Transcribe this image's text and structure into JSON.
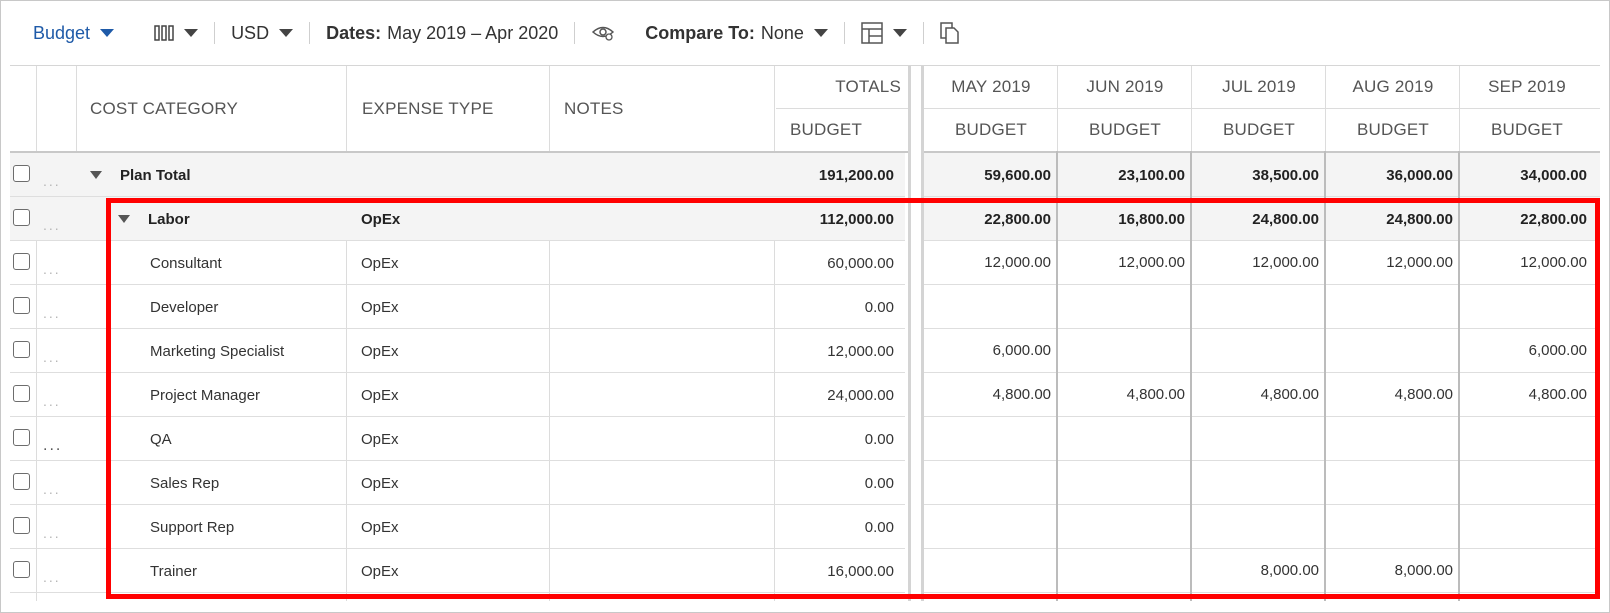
{
  "toolbar": {
    "view": "Budget",
    "currency": "USD",
    "dates_label": "Dates:",
    "dates_value": "May 2019 – Apr 2020",
    "compare_label": "Compare To:",
    "compare_value": "None",
    "icons": [
      "columns-icon",
      "eye-settings-icon",
      "table-layout-icon",
      "copy-icon"
    ]
  },
  "columns": {
    "cost_category": "COST CATEGORY",
    "expense_type": "EXPENSE TYPE",
    "notes": "NOTES",
    "totals": "TOTALS",
    "budget": "BUDGET",
    "months": [
      "MAY 2019",
      "JUN 2019",
      "JUL 2019",
      "AUG 2019",
      "SEP 2019"
    ],
    "month_sub": [
      "BUDGET",
      "BUDGET",
      "BUDGET",
      "BUDGET",
      "BUDGET"
    ]
  },
  "plan_total": {
    "label": "Plan Total",
    "total": "191,200.00",
    "months": [
      "59,600.00",
      "23,100.00",
      "38,500.00",
      "36,000.00",
      "34,000.00"
    ]
  },
  "labor": {
    "label": "Labor",
    "type": "OpEx",
    "total": "112,000.00",
    "months": [
      "22,800.00",
      "16,800.00",
      "24,800.00",
      "24,800.00",
      "22,800.00"
    ]
  },
  "rows": [
    {
      "label": "Consultant",
      "type": "OpEx",
      "total": "60,000.00",
      "months": [
        "12,000.00",
        "12,000.00",
        "12,000.00",
        "12,000.00",
        "12,000.00"
      ]
    },
    {
      "label": "Developer",
      "type": "OpEx",
      "total": "0.00",
      "months": [
        "",
        "",
        "",
        "",
        ""
      ]
    },
    {
      "label": "Marketing Specialist",
      "type": "OpEx",
      "total": "12,000.00",
      "months": [
        "6,000.00",
        "",
        "",
        "",
        "6,000.00"
      ]
    },
    {
      "label": "Project Manager",
      "type": "OpEx",
      "total": "24,000.00",
      "months": [
        "4,800.00",
        "4,800.00",
        "4,800.00",
        "4,800.00",
        "4,800.00"
      ]
    },
    {
      "label": "QA",
      "type": "OpEx",
      "total": "0.00",
      "months": [
        "",
        "",
        "",
        "",
        ""
      ]
    },
    {
      "label": "Sales Rep",
      "type": "OpEx",
      "total": "0.00",
      "months": [
        "",
        "",
        "",
        "",
        ""
      ]
    },
    {
      "label": "Support Rep",
      "type": "OpEx",
      "total": "0.00",
      "months": [
        "",
        "",
        "",
        "",
        ""
      ]
    },
    {
      "label": "Trainer",
      "type": "OpEx",
      "total": "16,000.00",
      "months": [
        "",
        "",
        "8,000.00",
        "8,000.00",
        ""
      ]
    }
  ],
  "row_menu": "...",
  "colors": {
    "accent": "#1e5aa8",
    "highlight": "#ff0000"
  }
}
